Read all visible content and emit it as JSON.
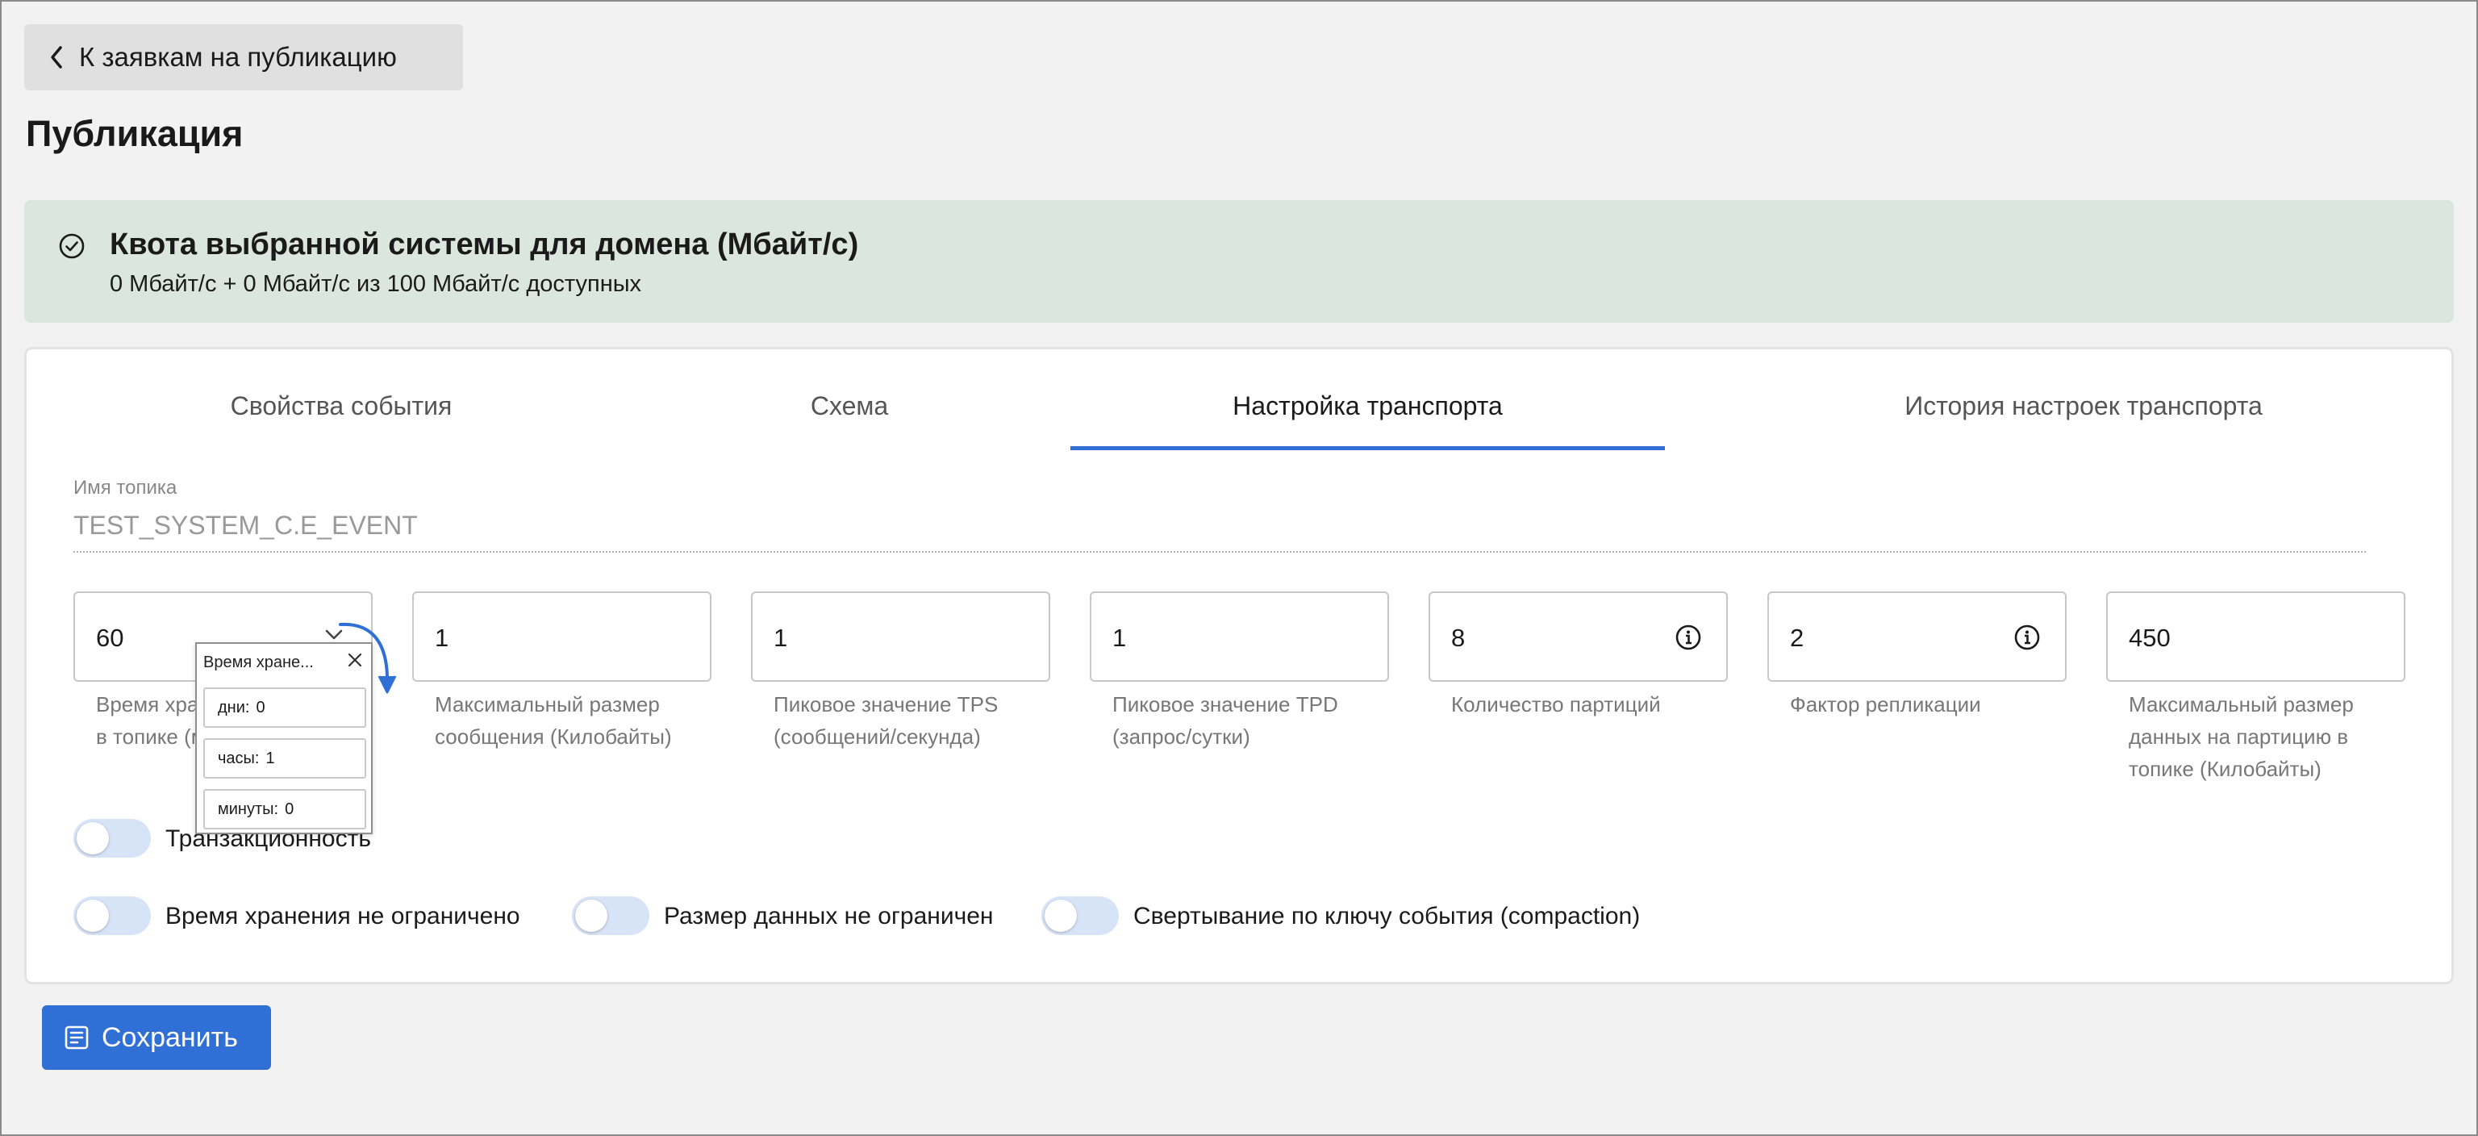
{
  "back_button": {
    "label": "К заявкам на публикацию"
  },
  "page_title": "Публикация",
  "quota": {
    "title": "Квота выбранной системы для домена (Мбайт/с)",
    "subtitle": "0 Мбайт/с + 0 Мбайт/с из 100 Мбайт/с доступных",
    "status_color": "#dbe6de"
  },
  "tabs": [
    {
      "label": "Свойства события",
      "active": false
    },
    {
      "label": "Схема",
      "active": false
    },
    {
      "label": "Настройка транспорта",
      "active": true
    },
    {
      "label": "История настроек транспорта",
      "active": false
    }
  ],
  "topic": {
    "label": "Имя топика",
    "value": "TEST_SYSTEM_C.E_EVENT"
  },
  "fields": [
    {
      "value": "60",
      "label": "Время хранения сообщений в топике (минуты)",
      "icon": "chevron-down-icon"
    },
    {
      "value": "1",
      "label": "Максимальный размер сообщения (Килобайты)"
    },
    {
      "value": "1",
      "label": "Пиковое значение TPS (сообщений/секунда)"
    },
    {
      "value": "1",
      "label": "Пиковое значение TPD (запрос/сутки)"
    },
    {
      "value": "8",
      "label": "Количество партиций",
      "icon": "info-icon"
    },
    {
      "value": "2",
      "label": "Фактор репликации",
      "icon": "info-icon"
    },
    {
      "value": "450",
      "label": "Максимальный размер данных на партицию в топике (Килобайты)"
    }
  ],
  "retention_popup": {
    "title": "Время хранения сообщений в топике",
    "title_display": "Время хране...",
    "rows": [
      {
        "label": "дни:",
        "value": "0"
      },
      {
        "label": "часы:",
        "value": "1"
      },
      {
        "label": "минуты:",
        "value": "0"
      }
    ]
  },
  "toggles": [
    {
      "label": "Транзакционность",
      "on": false
    },
    {
      "label": "Время хранения не ограничено",
      "on": false
    },
    {
      "label": "Размер данных не ограничен",
      "on": false
    },
    {
      "label": "Свертывание по ключу события (compaction)",
      "on": false
    }
  ],
  "save_button": {
    "label": "Сохранить"
  },
  "colors": {
    "accent": "#2f6fd6",
    "toggle_off": "#d7e3f7",
    "background": "#f2f2f2"
  }
}
